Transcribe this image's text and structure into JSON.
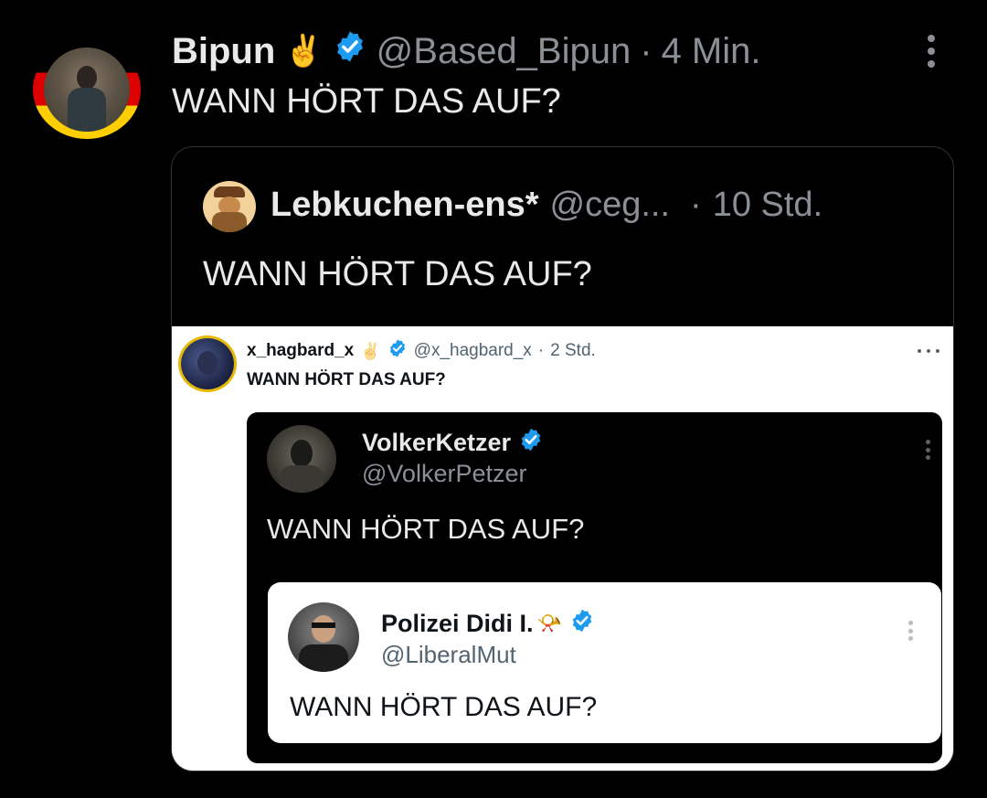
{
  "colors": {
    "background": "#000000",
    "text_primary": "#e7e9ea",
    "text_secondary": "#8b9096",
    "verified_blue": "#1d9bf0",
    "card_border": "#2f3336"
  },
  "post": {
    "display_name": "Bipun",
    "emoji": "✌️",
    "handle": "@Based_Bipun",
    "separator": "·",
    "time": "4 Min.",
    "text": "WANN HÖRT DAS AUF?",
    "avatar_icon": "avatar-photo-german-flag-ring",
    "more_icon": "more-vertical-icon"
  },
  "quote1": {
    "display_name": "Lebkuchen-ens*",
    "handle": "@ceg...",
    "separator": "·",
    "time": "10 Std.",
    "text": "WANN HÖRT DAS AUF?"
  },
  "quote2": {
    "display_name": "x_hagbard_x",
    "emoji": "✌️",
    "handle": "@x_hagbard_x",
    "separator": "·",
    "time": "2 Std.",
    "text": "WANN HÖRT DAS AUF?"
  },
  "quote3": {
    "display_name": "VolkerKetzer",
    "handle": "@VolkerPetzer",
    "text": "WANN HÖRT DAS AUF?"
  },
  "quote4": {
    "display_name": "Polizei Didi I.",
    "emoji": "📯",
    "handle": "@LiberalMut",
    "text": "WANN HÖRT DAS AUF?"
  }
}
